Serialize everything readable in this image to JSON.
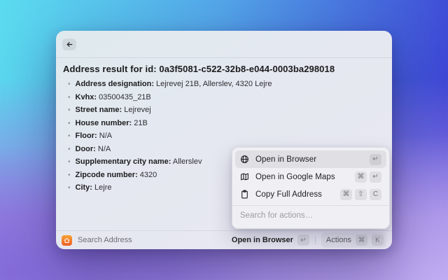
{
  "window": {
    "title": "Address result for id: 0a3f5081-c522-32b8-e044-0003ba298018",
    "fields": [
      {
        "label": "Address designation:",
        "value": " Lejrevej 21B, Allerslev, 4320 Lejre"
      },
      {
        "label": "Kvhx:",
        "value": " 03500435_21B"
      },
      {
        "label": "Street name:",
        "value": " Lejrevej"
      },
      {
        "label": "House number:",
        "value": " 21B"
      },
      {
        "label": "Floor:",
        "value": " N/A"
      },
      {
        "label": "Door:",
        "value": " N/A"
      },
      {
        "label": "Supplementary city name:",
        "value": " Allerslev"
      },
      {
        "label": "Zipcode number:",
        "value": " 4320"
      },
      {
        "label": "City:",
        "value": " Lejre"
      }
    ]
  },
  "actions_menu": {
    "items": [
      {
        "label": "Open in Browser",
        "icon": "globe-icon",
        "keys": [
          "↵"
        ],
        "selected": true
      },
      {
        "label": "Open in Google Maps",
        "icon": "map-icon",
        "keys": [
          "⌘",
          "↵"
        ],
        "selected": false
      },
      {
        "label": "Copy Full Address",
        "icon": "clipboard-icon",
        "keys": [
          "⌘",
          "⇧",
          "C"
        ],
        "selected": false
      }
    ],
    "search_placeholder": "Search for actions…"
  },
  "footer": {
    "app_icon": "home-icon",
    "app_name": "Search Address",
    "primary_action": {
      "label": "Open in Browser",
      "keys": [
        "↵"
      ]
    },
    "actions": {
      "label": "Actions",
      "keys": [
        "⌘",
        "K"
      ]
    }
  },
  "colors": {
    "accent_orange": "#ee5f28",
    "bg_gradient_top_left": "#5bdcef",
    "bg_gradient_top_right": "#3b3ad2",
    "bg_gradient_bottom": "#9c84e2",
    "window_bg": "#e5e8f0"
  }
}
